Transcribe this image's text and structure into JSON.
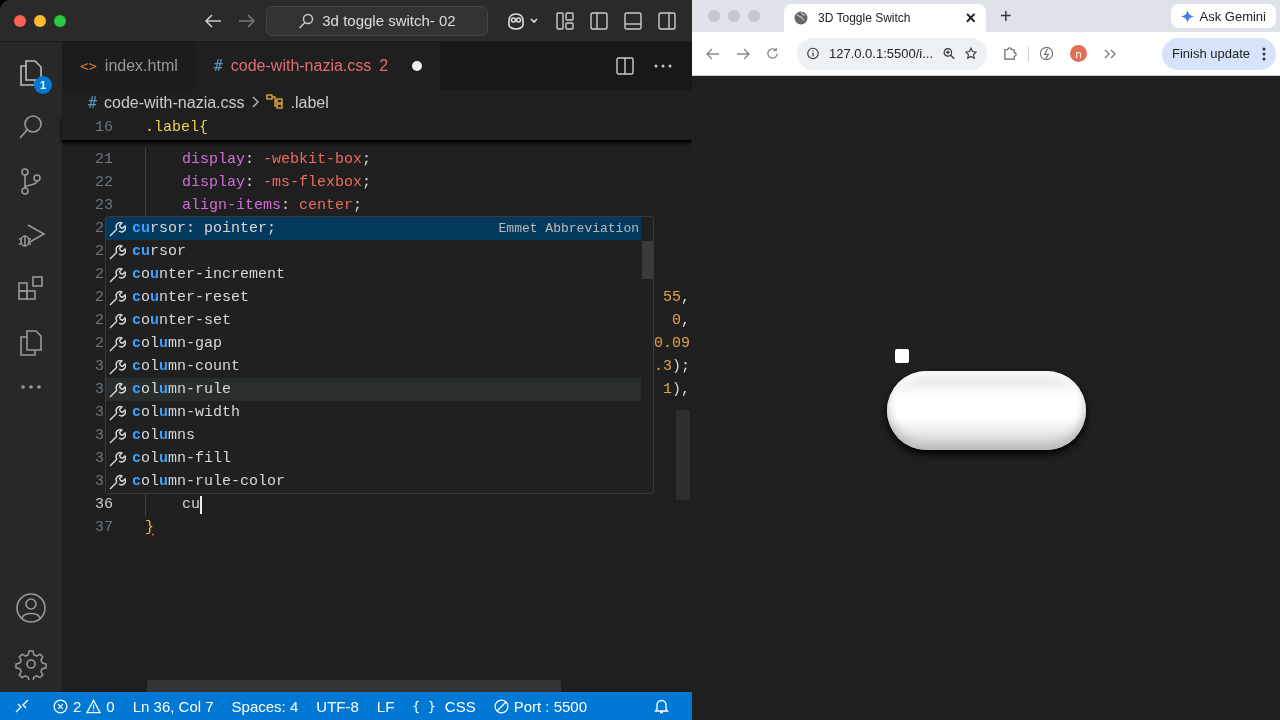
{
  "titlebar": {
    "search": "3d toggle switch- 02"
  },
  "activity_bar": {
    "explorer_badge": "1"
  },
  "tabs": [
    {
      "label": "index.html",
      "icon": "<>",
      "kind": "html",
      "selected": false,
      "modified": false
    },
    {
      "label": "code-with-nazia.css",
      "icon": "#",
      "kind": "css",
      "selected": true,
      "problems": "2",
      "modified": true
    }
  ],
  "breadcrumb": {
    "file_icon": "#",
    "file": "code-with-nazia.css",
    "symbol": ".label"
  },
  "editor": {
    "sticky": {
      "number": "16",
      "tokens": [
        {
          "t": ".label{",
          "kind": "selector"
        }
      ]
    },
    "lines": [
      {
        "number": "21",
        "indent": true,
        "tokens": [
          {
            "t": "display",
            "kind": "property"
          },
          {
            "t": ": ",
            "kind": "punct"
          },
          {
            "t": "-webkit-box",
            "kind": "value"
          },
          {
            "t": ";",
            "kind": "punct"
          }
        ]
      },
      {
        "number": "22",
        "indent": true,
        "tokens": [
          {
            "t": "display",
            "kind": "property"
          },
          {
            "t": ": ",
            "kind": "punct"
          },
          {
            "t": "-ms-flexbox",
            "kind": "value"
          },
          {
            "t": ";",
            "kind": "punct"
          }
        ]
      },
      {
        "number": "23",
        "indent": true,
        "tokens": [
          {
            "t": "align-items",
            "kind": "property"
          },
          {
            "t": ": ",
            "kind": "punct"
          },
          {
            "t": "center",
            "kind": "value"
          },
          {
            "t": ";",
            "kind": "punct"
          }
        ]
      },
      {
        "number": "2"
      },
      {
        "number": "2"
      },
      {
        "number": "2"
      },
      {
        "number": "2",
        "tail": [
          {
            "t": "55",
            "kind": "number"
          },
          {
            "t": ",",
            "kind": "punct"
          }
        ]
      },
      {
        "number": "2",
        "tail": [
          {
            "t": "0",
            "kind": "number"
          },
          {
            "t": ",",
            "kind": "punct"
          }
        ]
      },
      {
        "number": "2",
        "tail": [
          {
            "t": "0.09",
            "kind": "number"
          }
        ]
      },
      {
        "number": "3",
        "tail": [
          {
            "t": ".3",
            "kind": "number"
          },
          {
            "t": ");",
            "kind": "punct"
          }
        ]
      },
      {
        "number": "3",
        "tail": [
          {
            "t": "1",
            "kind": "number"
          },
          {
            "t": "),",
            "kind": "punct"
          }
        ]
      },
      {
        "number": "3"
      },
      {
        "number": "3"
      },
      {
        "number": "3"
      },
      {
        "number": "3"
      },
      {
        "number": "36",
        "current": true,
        "indent": true,
        "tokens": [
          {
            "t": "cu",
            "kind": "punct"
          }
        ],
        "cursor": true
      },
      {
        "number": "37",
        "tokens": [
          {
            "t": "}",
            "kind": "brace"
          }
        ]
      }
    ]
  },
  "suggestions": [
    {
      "parts": [
        "cu",
        "rsor: pointer;"
      ],
      "detail": "Emmet Abbreviation",
      "selected": true,
      "hovered": false
    },
    {
      "parts": [
        "cu",
        "rsor"
      ],
      "selected": false,
      "hovered": false
    },
    {
      "parts": [
        "c",
        "o",
        "u",
        "nter-increment"
      ],
      "selected": false,
      "hovered": false
    },
    {
      "parts": [
        "c",
        "o",
        "u",
        "nter-reset"
      ],
      "selected": false,
      "hovered": false
    },
    {
      "parts": [
        "c",
        "o",
        "u",
        "nter-set"
      ],
      "selected": false,
      "hovered": false
    },
    {
      "parts": [
        "c",
        "ol",
        "u",
        "mn-gap"
      ],
      "selected": false,
      "hovered": false
    },
    {
      "parts": [
        "c",
        "ol",
        "u",
        "mn-count"
      ],
      "selected": false,
      "hovered": false
    },
    {
      "parts": [
        "c",
        "ol",
        "u",
        "mn-rule"
      ],
      "selected": false,
      "hovered": true
    },
    {
      "parts": [
        "c",
        "ol",
        "u",
        "mn-width"
      ],
      "selected": false,
      "hovered": false
    },
    {
      "parts": [
        "c",
        "ol",
        "u",
        "mns"
      ],
      "selected": false,
      "hovered": false
    },
    {
      "parts": [
        "c",
        "ol",
        "u",
        "mn-fill"
      ],
      "selected": false,
      "hovered": false
    },
    {
      "parts": [
        "c",
        "ol",
        "u",
        "mn-rule-color"
      ],
      "selected": false,
      "hovered": false
    }
  ],
  "status_bar": {
    "errors": "2",
    "warnings": "0",
    "position": "Ln 36, Col 7",
    "indent": "Spaces: 4",
    "encoding": "UTF-8",
    "eol": "LF",
    "lang_icon": "{ }",
    "language": "CSS",
    "port": "Port : 5500"
  },
  "browser": {
    "tab": {
      "title": "3D Toggle Switch",
      "close": "×"
    },
    "new_tab": "+",
    "gemini": "Ask Gemini",
    "url": "127.0.0.1:5500/i...",
    "profile": "n",
    "update": "Finish update",
    "page": {
      "checkbox": {
        "checked": false
      },
      "toggle": {
        "on": false
      }
    }
  }
}
